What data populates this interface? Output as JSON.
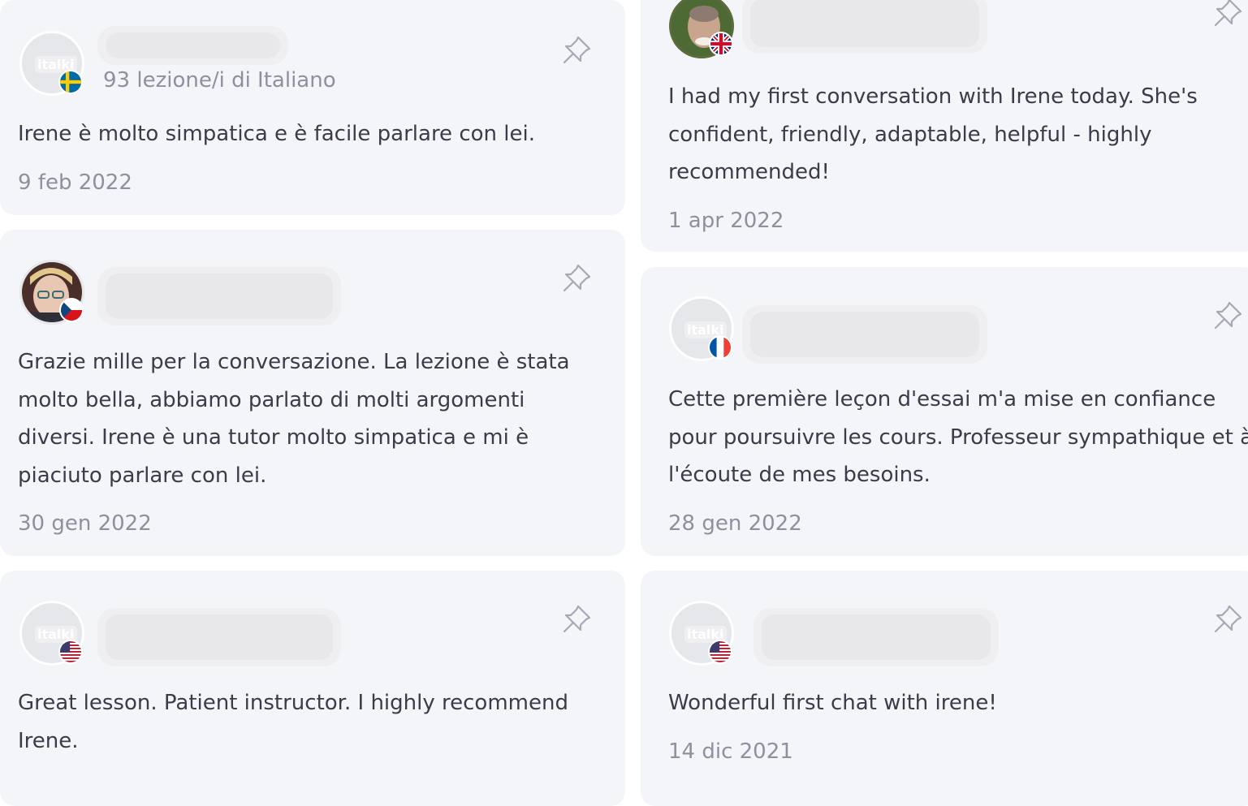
{
  "reviews": [
    {
      "id": "r1",
      "flag": "sweden",
      "avatar": "placeholder",
      "logo_text": "italki",
      "lessons": "93 lezione/i di Italiano",
      "text": "Irene è molto simpatica e è facile parlare con lei.",
      "date": "9 feb 2022"
    },
    {
      "id": "r2",
      "flag": "uk",
      "avatar": "photo",
      "text": "I had my first conversation with Irene today. She's confident, friendly, adaptable, helpful - highly recommended!",
      "date": "1 apr 2022"
    },
    {
      "id": "r3",
      "flag": "czech",
      "avatar": "photo",
      "text": "Grazie mille per la conversazione. La lezione è stata molto bella, abbiamo parlato di molti argomenti diversi. Irene è una tutor molto simpatica e mi è piaciuto parlare con lei.",
      "date": "30 gen 2022"
    },
    {
      "id": "r4",
      "flag": "france",
      "avatar": "placeholder",
      "logo_text": "italki",
      "text": "Cette première leçon d'essai m'a mise en confiance pour poursuivre les cours. Professeur sympathique et à l'écoute de mes besoins.",
      "date": "28 gen 2022"
    },
    {
      "id": "r5",
      "flag": "usa",
      "avatar": "placeholder",
      "logo_text": "italki",
      "text": "Great lesson. Patient instructor. I highly recommend Irene."
    },
    {
      "id": "r6",
      "flag": "usa",
      "avatar": "placeholder",
      "logo_text": "italki",
      "text": "Wonderful first chat with irene!",
      "date": "14 dic 2021"
    }
  ],
  "icons": {
    "pin": "pin-icon"
  },
  "colors": {
    "card_bg": "#f4f5f9",
    "text": "#3b3b4a",
    "muted": "#8e90a0"
  }
}
